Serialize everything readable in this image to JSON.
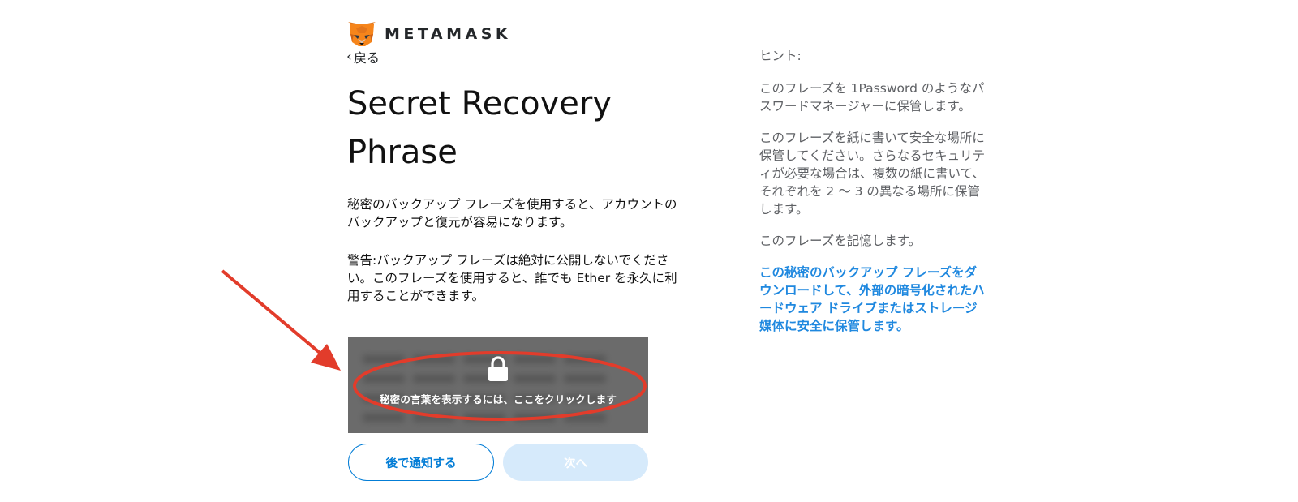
{
  "header": {
    "logo_text": "METAMASK",
    "back_label": "戻る"
  },
  "main": {
    "title": "Secret Recovery Phrase",
    "description": "秘密のバックアップ フレーズを使用すると、アカウントのバックアップと復元が容易になります。",
    "warning": "警告:バックアップ フレーズは絶対に公開しないでください。このフレーズを使用すると、誰でも Ether を永久に利用することができます。",
    "reveal_label": "秘密の言葉を表示するには、ここをクリックします"
  },
  "buttons": {
    "remind_later": "後で通知する",
    "next": "次へ"
  },
  "hints": {
    "heading": "ヒント:",
    "tip1": "このフレーズを 1Password のようなパスワードマネージャーに保管します。",
    "tip2": "このフレーズを紙に書いて安全な場所に保管してください。さらなるセキュリティが必要な場合は、複数の紙に書いて、それぞれを 2 〜 3 の異なる場所に保管します。",
    "tip3": "このフレーズを記憶します。",
    "download_link": "この秘密のバックアップ フレーズをダウンロードして、外部の暗号化されたハードウェア ドライブまたはストレージ媒体に安全に保管します。"
  },
  "colors": {
    "accent": "#037dd6",
    "link": "#1f88df",
    "disabled_button": "#d6eafb",
    "reveal_background": "#6b6b6b",
    "annotation": "#e23c2b",
    "fox_orange": "#e2761b"
  },
  "icons": {
    "logo": "metamask-fox-icon",
    "back": "chevron-left-icon",
    "lock": "lock-icon",
    "annotation_arrow": "arrow-icon"
  }
}
